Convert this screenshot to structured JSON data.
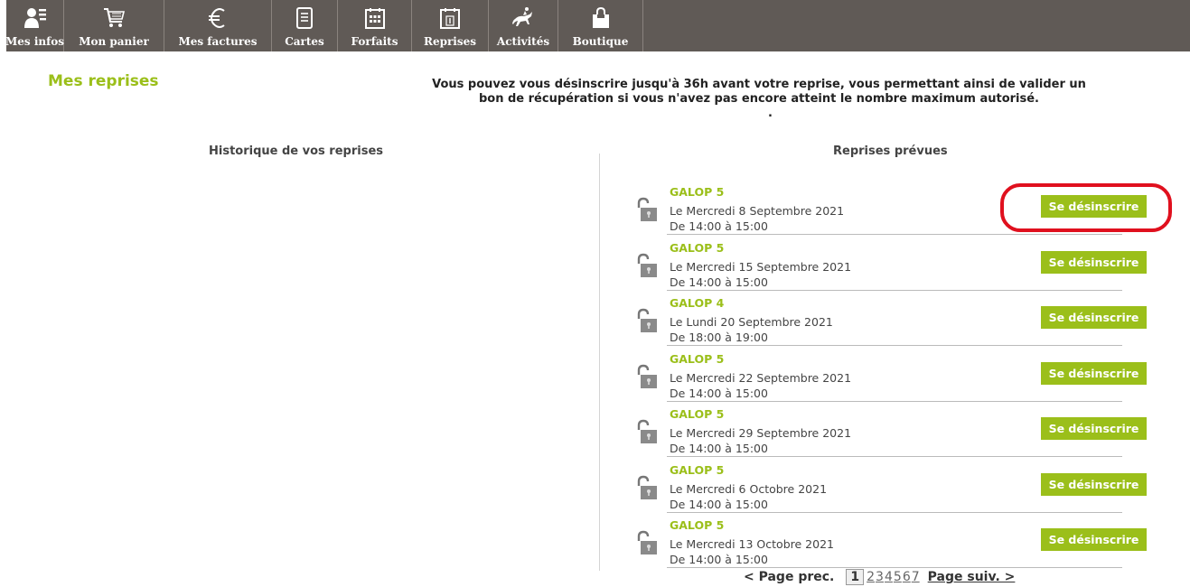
{
  "nav": {
    "items": [
      {
        "label": "Mes infos",
        "icon": "user-icon"
      },
      {
        "label": "Mon panier",
        "icon": "cart-icon"
      },
      {
        "label": "Mes factures",
        "icon": "euro-icon"
      },
      {
        "label": "Cartes",
        "icon": "card-icon"
      },
      {
        "label": "Forfaits",
        "icon": "calendar-grid-icon"
      },
      {
        "label": "Reprises",
        "icon": "calendar-day-icon"
      },
      {
        "label": "Activités",
        "icon": "horse-rider-icon"
      },
      {
        "label": "Boutique",
        "icon": "shopping-bag-icon"
      }
    ]
  },
  "page": {
    "title": "Mes reprises",
    "notice_line1": "Vous pouvez vous désinscrire jusqu'à 36h avant votre reprise, vous permettant ainsi de valider un",
    "notice_line2": "bon de récupération si vous n'avez pas encore atteint le nombre maximum autorisé.",
    "notice_dot": ".",
    "history_heading": "Historique de vos reprises",
    "planned_heading": "Reprises prévues"
  },
  "sessions": [
    {
      "title": "GALOP 5",
      "date": "Le Mercredi 8 Septembre 2021",
      "time": "De 14:00 à 15:00",
      "button": "Se désinscrire"
    },
    {
      "title": "GALOP 5",
      "date": "Le Mercredi 15 Septembre 2021",
      "time": "De 14:00 à 15:00",
      "button": "Se désinscrire"
    },
    {
      "title": "GALOP 4",
      "date": "Le Lundi 20 Septembre 2021",
      "time": "De 18:00 à 19:00",
      "button": "Se désinscrire"
    },
    {
      "title": "GALOP 5",
      "date": "Le Mercredi 22 Septembre 2021",
      "time": "De 14:00 à 15:00",
      "button": "Se désinscrire"
    },
    {
      "title": "GALOP 5",
      "date": "Le Mercredi 29 Septembre 2021",
      "time": "De 14:00 à 15:00",
      "button": "Se désinscrire"
    },
    {
      "title": "GALOP 5",
      "date": "Le Mercredi 6 Octobre 2021",
      "time": "De 14:00 à 15:00",
      "button": "Se désinscrire"
    },
    {
      "title": "GALOP 5",
      "date": "Le Mercredi 13 Octobre 2021",
      "time": "De 14:00 à 15:00",
      "button": "Se désinscrire"
    }
  ],
  "pager": {
    "prev": "< Page prec.",
    "current": "1",
    "pages": [
      "2",
      "3",
      "4",
      "5",
      "6",
      "7"
    ],
    "next": "Page suiv. >"
  },
  "colors": {
    "accent": "#9bbf1a",
    "nav_bg": "#605a56",
    "highlight": "#e0101e"
  }
}
